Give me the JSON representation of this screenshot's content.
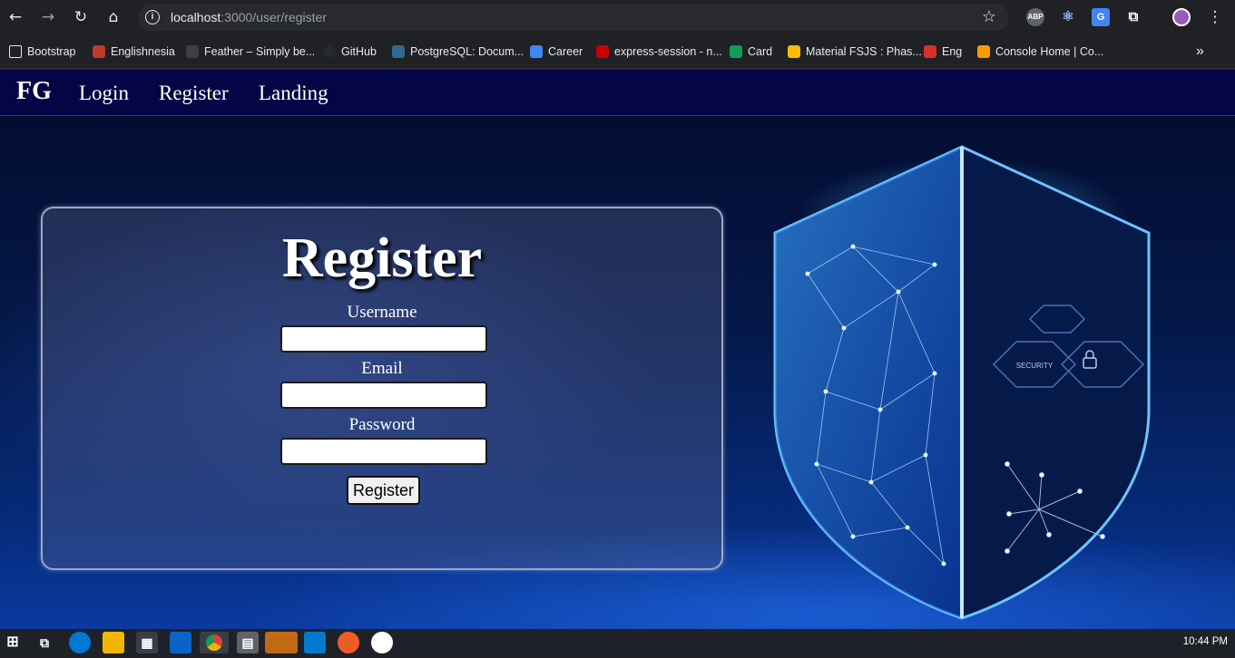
{
  "browser": {
    "url_host": "localhost",
    "url_path": ":3000/user/register",
    "back_icon": "arrow-left-icon",
    "forward_icon": "arrow-right-icon",
    "reload_icon": "reload-icon",
    "home_icon": "home-icon",
    "bookmark_star_icon": "star-icon",
    "extensions": [
      "ABP",
      "⚛",
      "G",
      "⧉"
    ],
    "menu_icon": "kebab-menu-icon",
    "more_bookmarks": "»"
  },
  "bookmarks": [
    {
      "label": "Bootstrap",
      "color": "#3c4043"
    },
    {
      "label": "Englishnesia",
      "color": "#c0392b"
    },
    {
      "label": "Feather – Simply be...",
      "color": "#3c4043"
    },
    {
      "label": "GitHub",
      "color": "#24292e"
    },
    {
      "label": "PostgreSQL: Docum...",
      "color": "#336791"
    },
    {
      "label": "Career",
      "color": "#4285f4"
    },
    {
      "label": "express-session - n...",
      "color": "#cb0000"
    },
    {
      "label": "Card",
      "color": "#0f9d58"
    },
    {
      "label": "Material FSJS : Phas...",
      "color": "#fbbc04"
    },
    {
      "label": "Eng",
      "color": "#d93025"
    },
    {
      "label": "Console Home | Co...",
      "color": "#ff9900"
    }
  ],
  "app_nav": {
    "brand": "FG",
    "links": [
      "Login",
      "Register",
      "Landing"
    ]
  },
  "form": {
    "title": "Register",
    "username_label": "Username",
    "email_label": "Email",
    "password_label": "Password",
    "username_value": "",
    "email_value": "",
    "password_value": "",
    "submit_label": "Register"
  },
  "shield": {
    "security_text": "SECURITY"
  },
  "taskbar": {
    "clock": "10:44 PM"
  }
}
